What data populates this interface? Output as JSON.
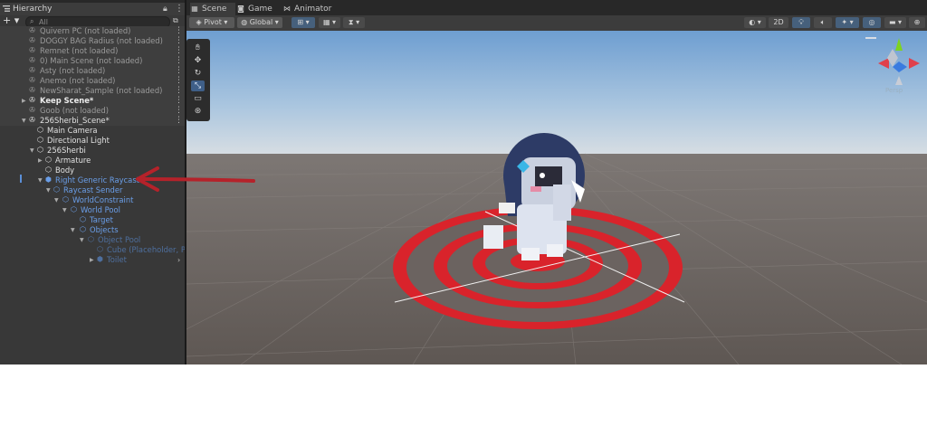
{
  "hierarchy": {
    "tab_label": "Hierarchy",
    "add_label": "+ ▾",
    "search_placeholder": "All",
    "rows": [
      {
        "label": "Quivern PC (not loaded)",
        "kind": "scene-unloaded"
      },
      {
        "label": "DOGGY BAG Radius (not loaded)",
        "kind": "scene-unloaded"
      },
      {
        "label": "Remnet (not loaded)",
        "kind": "scene-unloaded"
      },
      {
        "label": "0) Main Scene (not loaded)",
        "kind": "scene-unloaded"
      },
      {
        "label": "Asty (not loaded)",
        "kind": "scene-unloaded"
      },
      {
        "label": "Anemo (not loaded)",
        "kind": "scene-unloaded"
      },
      {
        "label": "NewSharat_Sample (not loaded)",
        "kind": "scene-unloaded"
      },
      {
        "label": "Keep Scene*",
        "kind": "scene-loaded"
      },
      {
        "label": "Goob (not loaded)",
        "kind": "scene-unloaded"
      },
      {
        "label": "256Sherbi_Scene*",
        "kind": "scene-loaded"
      },
      {
        "label": "Main Camera",
        "kind": "object"
      },
      {
        "label": "Directional Light",
        "kind": "object"
      },
      {
        "label": "256Sherbi",
        "kind": "object"
      },
      {
        "label": "Armature",
        "kind": "object"
      },
      {
        "label": "Body",
        "kind": "object"
      },
      {
        "label": "Right Generic Raycast",
        "kind": "prefab-selected"
      },
      {
        "label": "Raycast Sender",
        "kind": "prefab"
      },
      {
        "label": "WorldConstraint",
        "kind": "prefab"
      },
      {
        "label": "World Pool",
        "kind": "prefab"
      },
      {
        "label": "Target",
        "kind": "prefab"
      },
      {
        "label": "Objects",
        "kind": "prefab"
      },
      {
        "label": "Object Pool",
        "kind": "prefab-dim"
      },
      {
        "label": "Cube (Placeholder, Pla",
        "kind": "prefab-dim"
      },
      {
        "label": "Toilet",
        "kind": "prefab-dim"
      }
    ]
  },
  "scene_view": {
    "tabs": [
      {
        "label": "Scene",
        "icon": "grid-icon"
      },
      {
        "label": "Game",
        "icon": "gamepad-icon"
      },
      {
        "label": "Animator",
        "icon": "animator-icon"
      }
    ],
    "pivot_label": "Pivot",
    "global_label": "Global",
    "toggle_2d_label": "2D",
    "gizmo_label": "Persp"
  },
  "colors": {
    "accent": "#3f5f88",
    "prefab_blue": "#6a9ee8",
    "annotation_red": "#c0232a",
    "target_red": "#d9232b"
  }
}
